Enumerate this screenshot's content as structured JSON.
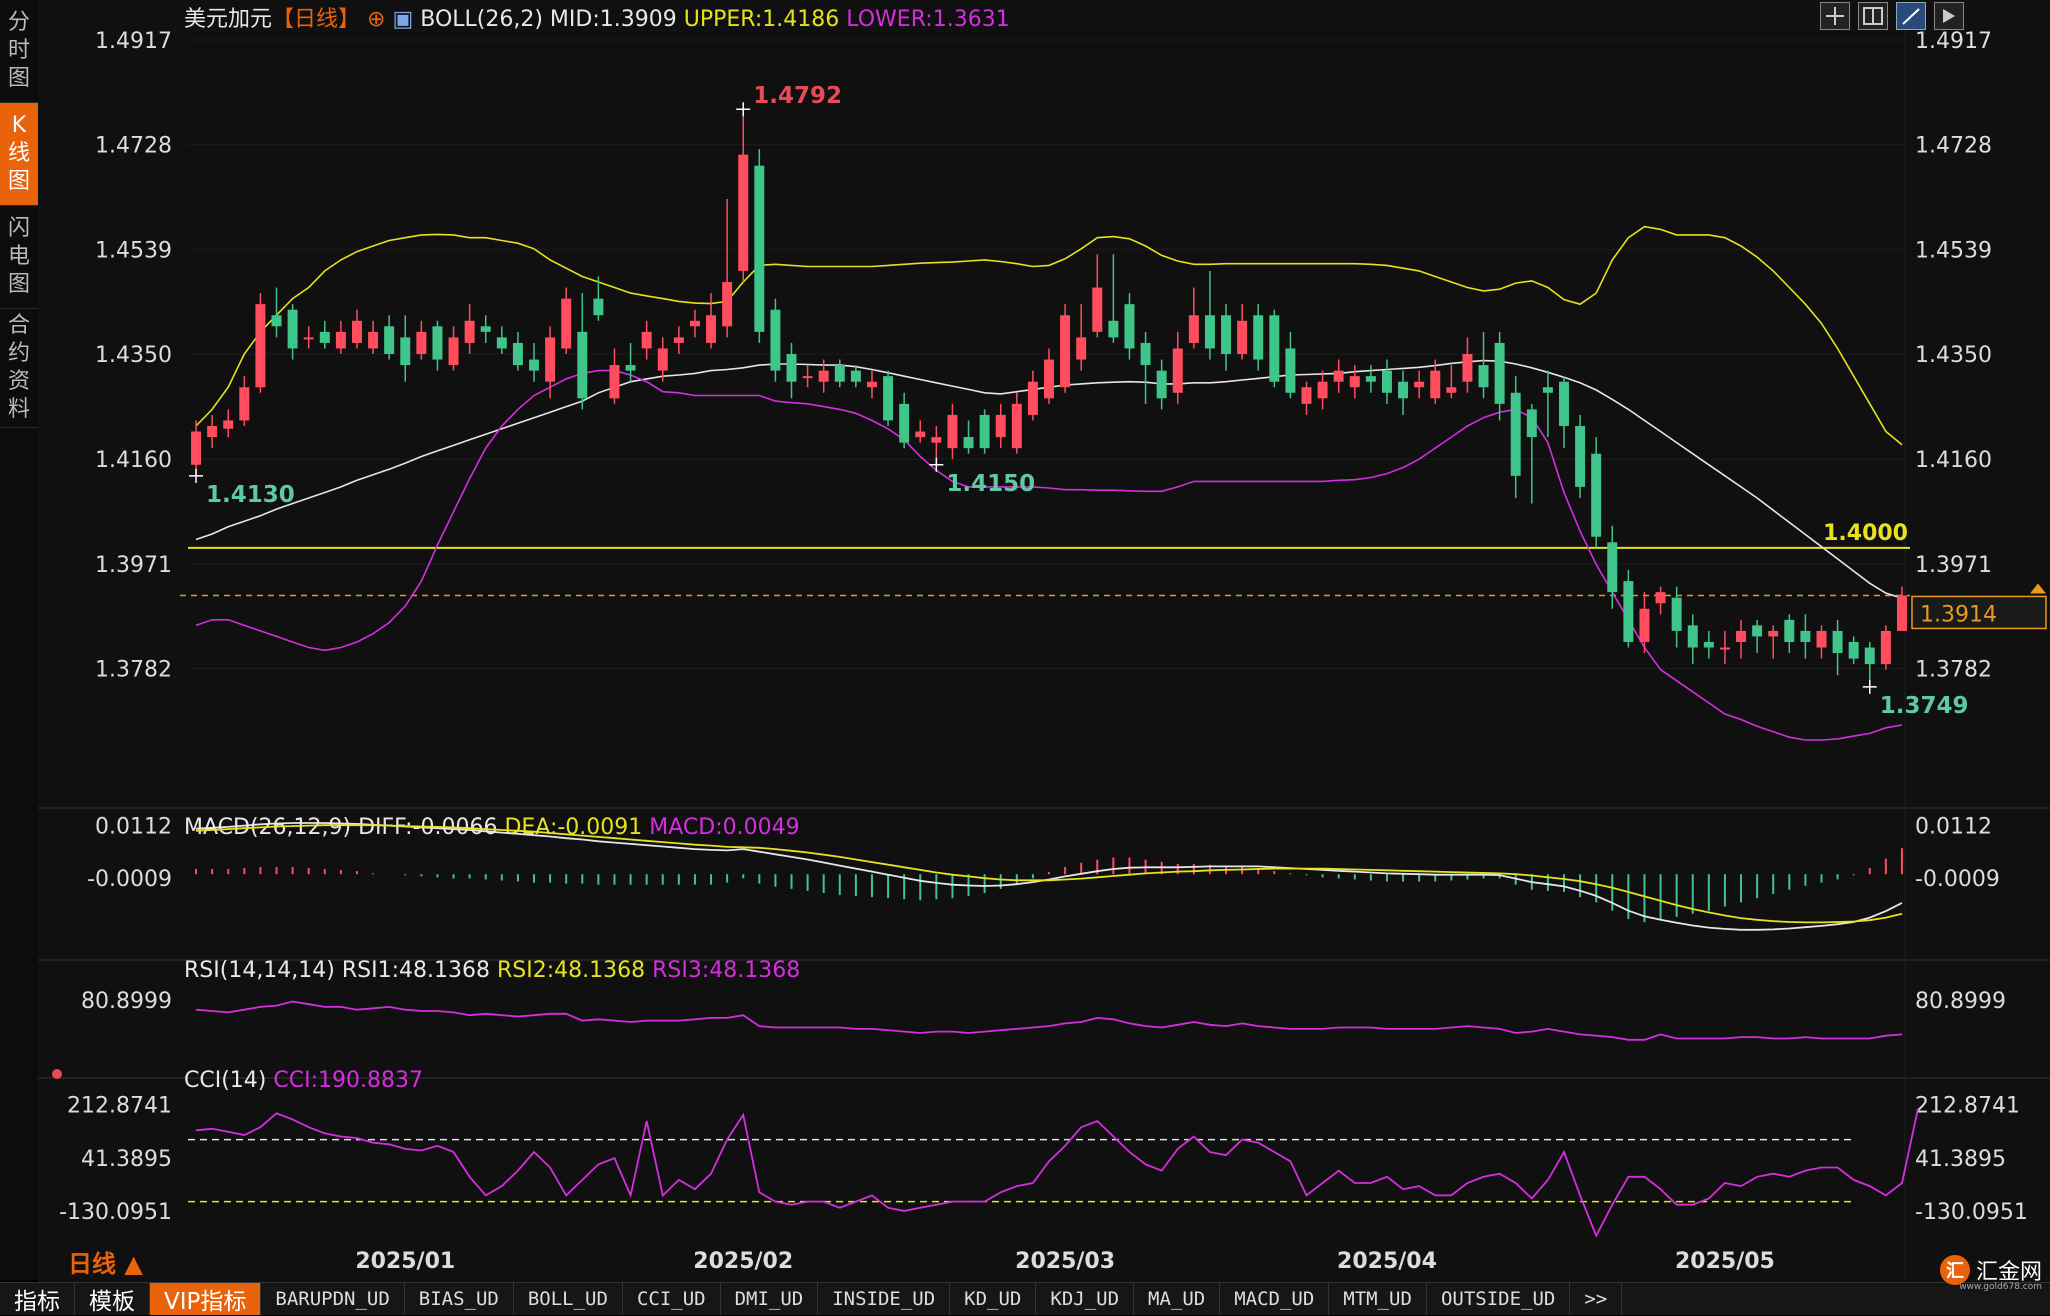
{
  "left_tabs": [
    {
      "label": "分\n时\n图"
    },
    {
      "label": "K\n线\n图"
    },
    {
      "label": "闪\n电\n图"
    },
    {
      "label": "合\n约\n资\n料"
    }
  ],
  "header": {
    "symbol": "美元加元",
    "period": "【日线】",
    "indicator": "BOLL(26,2)",
    "mid": "MID:1.3909",
    "upper": "UPPER:1.4186",
    "lower": "LOWER:1.3631"
  },
  "macd_header": {
    "name": "MACD(26,12,9)",
    "diff": "DIFF:-0.0066",
    "dea": "DEA:-0.0091",
    "macd": "MACD:0.0049"
  },
  "rsi_header": {
    "name": "RSI(14,14,14)",
    "rsi1": "RSI1:48.1368",
    "rsi2": "RSI2:48.1368",
    "rsi3": "RSI3:48.1368"
  },
  "cci_header": {
    "name": "CCI(14)",
    "cci": "CCI:190.8837"
  },
  "period_label": "日线 ▲",
  "bottom_tabs": [
    "指标",
    "模板",
    "VIP指标",
    "BARUPDN_UD",
    "BIAS_UD",
    "BOLL_UD",
    "CCI_UD",
    "DMI_UD",
    "INSIDE_UD",
    "KD_UD",
    "KDJ_UD",
    "MA_UD",
    "MACD_UD",
    "MTM_UD",
    "OUTSIDE_UD",
    ">>"
  ],
  "brand": {
    "name": "汇金网",
    "url": "www.gold678.com"
  },
  "colors": {
    "up": "#ff4d5e",
    "down": "#3fc48a",
    "mid": "#e6e6e6",
    "upper": "#e6e21e",
    "lower": "#d52ee0",
    "hline": "#e6e21e",
    "lastline": "#e89a1e",
    "bg": "#101010"
  },
  "chart_data": {
    "type": "candlestick",
    "x_labels": [
      "2025/01",
      "2025/02",
      "2025/03",
      "2025/04",
      "2025/05"
    ],
    "x_label_index": [
      13,
      34,
      54,
      74,
      95
    ],
    "price_axis": {
      "ticks": [
        "1.4917",
        "1.4728",
        "1.4539",
        "1.4350",
        "1.4160",
        "1.3971",
        "1.3782"
      ],
      "ylim": [
        1.3653,
        1.4917
      ]
    },
    "annotations": {
      "high": "1.4792",
      "low_first": "1.4130",
      "low_mid": "1.4150",
      "low_last": "1.3749",
      "level": "1.4000",
      "last_price": "1.3914"
    },
    "level_line": 1.4,
    "last_price": 1.3914,
    "open": [
      1.415,
      1.42,
      1.4215,
      1.423,
      1.429,
      1.442,
      1.443,
      1.438,
      1.439,
      1.436,
      1.437,
      1.436,
      1.44,
      1.438,
      1.435,
      1.44,
      1.433,
      1.437,
      1.44,
      1.438,
      1.437,
      1.434,
      1.43,
      1.436,
      1.439,
      1.445,
      1.427,
      1.433,
      1.436,
      1.432,
      1.437,
      1.44,
      1.437,
      1.44,
      1.45,
      1.469,
      1.443,
      1.435,
      1.431,
      1.43,
      1.433,
      1.432,
      1.429,
      1.431,
      1.426,
      1.42,
      1.419,
      1.418,
      1.42,
      1.424,
      1.42,
      1.418,
      1.424,
      1.427,
      1.429,
      1.434,
      1.439,
      1.441,
      1.444,
      1.437,
      1.432,
      1.428,
      1.437,
      1.442,
      1.442,
      1.435,
      1.442,
      1.442,
      1.436,
      1.426,
      1.427,
      1.43,
      1.429,
      1.431,
      1.432,
      1.43,
      1.429,
      1.427,
      1.428,
      1.43,
      1.433,
      1.437,
      1.428,
      1.425,
      1.429,
      1.43,
      1.422,
      1.417,
      1.401,
      1.394,
      1.383,
      1.39,
      1.391,
      1.386,
      1.383,
      1.382,
      1.383,
      1.386,
      1.384,
      1.387,
      1.385,
      1.382,
      1.385,
      1.383,
      1.382,
      1.379,
      1.385
    ],
    "close": [
      1.421,
      1.422,
      1.423,
      1.429,
      1.444,
      1.44,
      1.436,
      1.438,
      1.437,
      1.439,
      1.441,
      1.439,
      1.435,
      1.433,
      1.439,
      1.434,
      1.438,
      1.441,
      1.439,
      1.436,
      1.433,
      1.432,
      1.438,
      1.445,
      1.427,
      1.442,
      1.433,
      1.432,
      1.439,
      1.436,
      1.438,
      1.441,
      1.442,
      1.448,
      1.471,
      1.439,
      1.432,
      1.43,
      1.431,
      1.432,
      1.43,
      1.43,
      1.43,
      1.423,
      1.419,
      1.421,
      1.42,
      1.424,
      1.418,
      1.418,
      1.424,
      1.426,
      1.43,
      1.434,
      1.442,
      1.438,
      1.447,
      1.438,
      1.436,
      1.433,
      1.427,
      1.436,
      1.442,
      1.436,
      1.435,
      1.441,
      1.434,
      1.43,
      1.428,
      1.429,
      1.43,
      1.432,
      1.431,
      1.43,
      1.428,
      1.427,
      1.43,
      1.432,
      1.429,
      1.435,
      1.429,
      1.426,
      1.413,
      1.42,
      1.428,
      1.422,
      1.411,
      1.402,
      1.392,
      1.383,
      1.389,
      1.392,
      1.385,
      1.382,
      1.382,
      1.382,
      1.385,
      1.384,
      1.385,
      1.383,
      1.383,
      1.385,
      1.381,
      1.38,
      1.379,
      1.385,
      1.3914
    ],
    "high": [
      1.423,
      1.424,
      1.425,
      1.431,
      1.446,
      1.447,
      1.444,
      1.44,
      1.441,
      1.441,
      1.443,
      1.441,
      1.442,
      1.442,
      1.441,
      1.441,
      1.44,
      1.444,
      1.442,
      1.44,
      1.439,
      1.437,
      1.44,
      1.447,
      1.446,
      1.449,
      1.436,
      1.437,
      1.441,
      1.438,
      1.44,
      1.443,
      1.446,
      1.463,
      1.4792,
      1.472,
      1.445,
      1.437,
      1.433,
      1.434,
      1.434,
      1.433,
      1.432,
      1.432,
      1.428,
      1.423,
      1.422,
      1.426,
      1.423,
      1.425,
      1.426,
      1.428,
      1.432,
      1.436,
      1.444,
      1.444,
      1.453,
      1.453,
      1.446,
      1.439,
      1.434,
      1.439,
      1.447,
      1.45,
      1.444,
      1.444,
      1.444,
      1.443,
      1.439,
      1.43,
      1.432,
      1.434,
      1.433,
      1.433,
      1.434,
      1.432,
      1.432,
      1.434,
      1.433,
      1.438,
      1.439,
      1.439,
      1.431,
      1.426,
      1.432,
      1.431,
      1.424,
      1.42,
      1.404,
      1.396,
      1.392,
      1.393,
      1.393,
      1.388,
      1.385,
      1.385,
      1.387,
      1.387,
      1.386,
      1.388,
      1.388,
      1.386,
      1.387,
      1.384,
      1.383,
      1.386,
      1.393
    ],
    "low": [
      1.413,
      1.418,
      1.42,
      1.422,
      1.428,
      1.438,
      1.434,
      1.436,
      1.436,
      1.435,
      1.436,
      1.435,
      1.434,
      1.43,
      1.434,
      1.432,
      1.432,
      1.435,
      1.437,
      1.435,
      1.432,
      1.43,
      1.427,
      1.435,
      1.425,
      1.441,
      1.426,
      1.43,
      1.434,
      1.43,
      1.435,
      1.438,
      1.436,
      1.438,
      1.448,
      1.437,
      1.43,
      1.427,
      1.429,
      1.428,
      1.429,
      1.429,
      1.427,
      1.422,
      1.418,
      1.419,
      1.415,
      1.416,
      1.417,
      1.417,
      1.418,
      1.417,
      1.423,
      1.426,
      1.428,
      1.432,
      1.438,
      1.437,
      1.434,
      1.426,
      1.425,
      1.426,
      1.436,
      1.434,
      1.432,
      1.434,
      1.432,
      1.429,
      1.427,
      1.424,
      1.425,
      1.428,
      1.427,
      1.428,
      1.426,
      1.424,
      1.427,
      1.426,
      1.427,
      1.428,
      1.427,
      1.423,
      1.409,
      1.408,
      1.42,
      1.418,
      1.409,
      1.4,
      1.389,
      1.382,
      1.381,
      1.388,
      1.382,
      1.379,
      1.38,
      1.379,
      1.38,
      1.381,
      1.38,
      1.381,
      1.38,
      1.38,
      1.377,
      1.379,
      1.3749,
      1.378,
      1.385
    ],
    "boll_mid": [
      1.4015,
      1.4025,
      1.4038,
      1.4048,
      1.4058,
      1.407,
      1.408,
      1.409,
      1.41,
      1.411,
      1.4122,
      1.4132,
      1.4142,
      1.4153,
      1.4165,
      1.4175,
      1.4185,
      1.4195,
      1.4205,
      1.4215,
      1.4225,
      1.4235,
      1.4245,
      1.4255,
      1.4265,
      1.428,
      1.429,
      1.43,
      1.4305,
      1.431,
      1.4312,
      1.4315,
      1.432,
      1.4322,
      1.4325,
      1.433,
      1.4332,
      1.4332,
      1.4331,
      1.433,
      1.433,
      1.4327,
      1.4322,
      1.4316,
      1.431,
      1.4304,
      1.4298,
      1.4292,
      1.4286,
      1.428,
      1.4278,
      1.4282,
      1.4286,
      1.429,
      1.4294,
      1.4296,
      1.4298,
      1.4299,
      1.43,
      1.4299,
      1.4296,
      1.4296,
      1.4298,
      1.4298,
      1.43,
      1.4303,
      1.4306,
      1.4309,
      1.4312,
      1.4313,
      1.4314,
      1.4315,
      1.4318,
      1.432,
      1.4322,
      1.4324,
      1.4326,
      1.4329,
      1.4333,
      1.4336,
      1.4338,
      1.4337,
      1.4332,
      1.4325,
      1.4317,
      1.4308,
      1.4298,
      1.4285,
      1.4268,
      1.425,
      1.423,
      1.421,
      1.419,
      1.417,
      1.415,
      1.413,
      1.411,
      1.409,
      1.4068,
      1.4046,
      1.4024,
      1.4002,
      1.398,
      1.3958,
      1.3936,
      1.3918,
      1.3909
    ],
    "boll_upper": [
      1.422,
      1.425,
      1.429,
      1.435,
      1.439,
      1.442,
      1.445,
      1.447,
      1.45,
      1.452,
      1.4535,
      1.4545,
      1.4555,
      1.456,
      1.4565,
      1.4566,
      1.4565,
      1.456,
      1.456,
      1.4555,
      1.455,
      1.454,
      1.452,
      1.4505,
      1.449,
      1.448,
      1.447,
      1.446,
      1.4455,
      1.445,
      1.4445,
      1.4442,
      1.4441,
      1.4445,
      1.448,
      1.451,
      1.4512,
      1.451,
      1.4508,
      1.4508,
      1.4508,
      1.4508,
      1.4508,
      1.451,
      1.4512,
      1.4514,
      1.4515,
      1.4516,
      1.4518,
      1.452,
      1.4517,
      1.4513,
      1.4508,
      1.451,
      1.4522,
      1.454,
      1.456,
      1.4562,
      1.4558,
      1.4545,
      1.4528,
      1.4518,
      1.4512,
      1.4512,
      1.4513,
      1.4513,
      1.4513,
      1.4513,
      1.4513,
      1.4513,
      1.4513,
      1.4513,
      1.4513,
      1.4512,
      1.451,
      1.4505,
      1.45,
      1.449,
      1.448,
      1.447,
      1.4464,
      1.4467,
      1.4478,
      1.4482,
      1.447,
      1.4448,
      1.444,
      1.446,
      1.452,
      1.456,
      1.458,
      1.4575,
      1.4565,
      1.4565,
      1.4565,
      1.456,
      1.4545,
      1.4525,
      1.45,
      1.447,
      1.444,
      1.4405,
      1.436,
      1.431,
      1.426,
      1.421,
      1.4186
    ],
    "boll_lower": [
      1.386,
      1.387,
      1.387,
      1.386,
      1.385,
      1.384,
      1.383,
      1.382,
      1.3815,
      1.382,
      1.383,
      1.3845,
      1.3865,
      1.3895,
      1.394,
      1.4005,
      1.4065,
      1.4125,
      1.418,
      1.422,
      1.425,
      1.4275,
      1.429,
      1.4305,
      1.4315,
      1.432,
      1.432,
      1.4312,
      1.43,
      1.4282,
      1.428,
      1.4275,
      1.4275,
      1.4275,
      1.4275,
      1.4275,
      1.4265,
      1.4262,
      1.426,
      1.4255,
      1.425,
      1.4243,
      1.423,
      1.4215,
      1.4195,
      1.4165,
      1.414,
      1.412,
      1.411,
      1.411,
      1.411,
      1.411,
      1.411,
      1.4108,
      1.4105,
      1.4105,
      1.4104,
      1.4104,
      1.4103,
      1.4102,
      1.4102,
      1.411,
      1.412,
      1.412,
      1.412,
      1.412,
      1.412,
      1.412,
      1.412,
      1.412,
      1.412,
      1.4122,
      1.4123,
      1.4127,
      1.4134,
      1.4145,
      1.416,
      1.418,
      1.42,
      1.422,
      1.4235,
      1.4245,
      1.425,
      1.4235,
      1.419,
      1.41,
      1.403,
      1.397,
      1.392,
      1.387,
      1.382,
      1.378,
      1.376,
      1.374,
      1.372,
      1.37,
      1.369,
      1.3678,
      1.3668,
      1.3658,
      1.3653,
      1.3653,
      1.3655,
      1.366,
      1.3665,
      1.3675,
      1.368
    ],
    "macd": {
      "diff": [
        0.0105,
        0.0107,
        0.0109,
        0.0112,
        0.0115,
        0.0117,
        0.0118,
        0.0118,
        0.0118,
        0.0117,
        0.0116,
        0.0114,
        0.0112,
        0.011,
        0.0108,
        0.0106,
        0.0104,
        0.0102,
        0.0099,
        0.0096,
        0.0093,
        0.009,
        0.0087,
        0.0083,
        0.008,
        0.0076,
        0.0073,
        0.007,
        0.0067,
        0.0064,
        0.0061,
        0.0058,
        0.0056,
        0.0055,
        0.0058,
        0.0052,
        0.0046,
        0.004,
        0.0034,
        0.0027,
        0.002,
        0.0013,
        0.0006,
        -0.0001,
        -0.0008,
        -0.0015,
        -0.002,
        -0.0024,
        -0.0026,
        -0.0027,
        -0.0026,
        -0.0023,
        -0.0018,
        -0.0012,
        -0.0005,
        0.0001,
        0.0007,
        0.0012,
        0.0015,
        0.0016,
        0.0016,
        0.0016,
        0.0017,
        0.0018,
        0.0018,
        0.0018,
        0.0018,
        0.0016,
        0.0014,
        0.0012,
        0.001,
        0.0008,
        0.0006,
        0.0004,
        0.0002,
        0.0001,
        0.0,
        -0.0001,
        -0.0001,
        -0.0001,
        -0.0001,
        -0.0002,
        -0.001,
        -0.0018,
        -0.0023,
        -0.0028,
        -0.0038,
        -0.005,
        -0.0066,
        -0.0084,
        -0.0097,
        -0.0105,
        -0.0112,
        -0.0118,
        -0.0123,
        -0.0126,
        -0.0128,
        -0.0128,
        -0.0127,
        -0.0125,
        -0.0122,
        -0.0119,
        -0.0115,
        -0.011,
        -0.01,
        -0.0085,
        -0.0066
      ],
      "dea": [
        0.01,
        0.0102,
        0.0104,
        0.0106,
        0.0108,
        0.011,
        0.0111,
        0.0112,
        0.0113,
        0.0113,
        0.0113,
        0.0113,
        0.0112,
        0.0111,
        0.011,
        0.0109,
        0.0108,
        0.0106,
        0.0104,
        0.0102,
        0.01,
        0.0098,
        0.0095,
        0.0092,
        0.0089,
        0.0086,
        0.0083,
        0.008,
        0.0077,
        0.0074,
        0.0071,
        0.0068,
        0.0066,
        0.0063,
        0.0062,
        0.0061,
        0.0058,
        0.0054,
        0.005,
        0.0045,
        0.004,
        0.0034,
        0.0028,
        0.0022,
        0.0016,
        0.001,
        0.0004,
        -0.0001,
        -0.0005,
        -0.0009,
        -0.0012,
        -0.0014,
        -0.0014,
        -0.0014,
        -0.0012,
        -0.001,
        -0.0007,
        -0.0004,
        -0.0001,
        0.0002,
        0.0004,
        0.0006,
        0.0007,
        0.0009,
        0.001,
        0.0011,
        0.0012,
        0.0013,
        0.0013,
        0.0013,
        0.0013,
        0.0012,
        0.0011,
        0.001,
        0.0009,
        0.0008,
        0.0007,
        0.0006,
        0.0005,
        0.0004,
        0.0003,
        0.0002,
        0.0,
        -0.0003,
        -0.0007,
        -0.0011,
        -0.0016,
        -0.0023,
        -0.0031,
        -0.0041,
        -0.0051,
        -0.0061,
        -0.0071,
        -0.008,
        -0.0088,
        -0.0095,
        -0.0101,
        -0.0105,
        -0.0108,
        -0.011,
        -0.0111,
        -0.0111,
        -0.011,
        -0.0109,
        -0.0106,
        -0.01,
        -0.0091
      ],
      "ylim": [
        -0.014,
        0.0125
      ]
    },
    "macd_axis_ticks": [
      "0.0112",
      "-0.0009"
    ],
    "rsi": {
      "values": [
        74,
        73,
        72,
        74,
        76,
        77,
        80,
        78,
        76,
        76,
        74,
        75,
        76,
        74,
        73,
        73,
        72,
        70,
        71,
        70,
        69,
        70,
        71,
        71,
        66,
        67,
        66,
        65,
        66,
        66,
        66,
        67,
        68,
        68,
        70,
        62,
        61,
        61,
        61,
        61,
        61,
        60,
        60,
        59,
        58,
        57,
        58,
        58,
        57,
        58,
        59,
        60,
        61,
        62,
        64,
        65,
        68,
        67,
        64,
        62,
        61,
        63,
        65,
        63,
        62,
        64,
        62,
        61,
        60,
        60,
        60,
        61,
        61,
        61,
        60,
        60,
        60,
        60,
        61,
        62,
        61,
        60,
        57,
        58,
        60,
        58,
        56,
        55,
        54,
        52,
        52,
        56,
        53,
        53,
        53,
        53,
        54,
        54,
        53,
        53,
        54,
        53,
        53,
        53,
        53,
        55,
        56
      ],
      "ylim": [
        30,
        92
      ]
    },
    "rsi_axis_ticks": [
      "80.8999"
    ],
    "cci": {
      "values": [
        130,
        135,
        125,
        115,
        140,
        185,
        165,
        140,
        120,
        110,
        105,
        90,
        85,
        70,
        65,
        80,
        60,
        -20,
        -80,
        -50,
        0,
        60,
        10,
        -80,
        -30,
        20,
        40,
        -80,
        160,
        -80,
        -30,
        -60,
        -10,
        100,
        180,
        -70,
        -100,
        -110,
        -100,
        -100,
        -120,
        -100,
        -80,
        -120,
        -130,
        -120,
        -110,
        -100,
        -100,
        -100,
        -70,
        -50,
        -40,
        30,
        80,
        140,
        160,
        110,
        60,
        20,
        0,
        70,
        110,
        60,
        50,
        100,
        90,
        60,
        30,
        -80,
        -40,
        0,
        -40,
        -40,
        -20,
        -60,
        -50,
        -80,
        -80,
        -40,
        -20,
        -10,
        -40,
        -90,
        -30,
        60,
        -80,
        -210,
        -110,
        -20,
        -20,
        -60,
        -110,
        -110,
        -90,
        -40,
        -50,
        -20,
        -10,
        -20,
        0,
        10,
        10,
        -30,
        -50,
        -80,
        -40,
        200
      ],
      "ylim": [
        -240,
        260
      ],
      "overbought": 100,
      "oversold": -100
    },
    "cci_axis_ticks": [
      "212.8741",
      "41.3895",
      "-130.0951"
    ]
  }
}
